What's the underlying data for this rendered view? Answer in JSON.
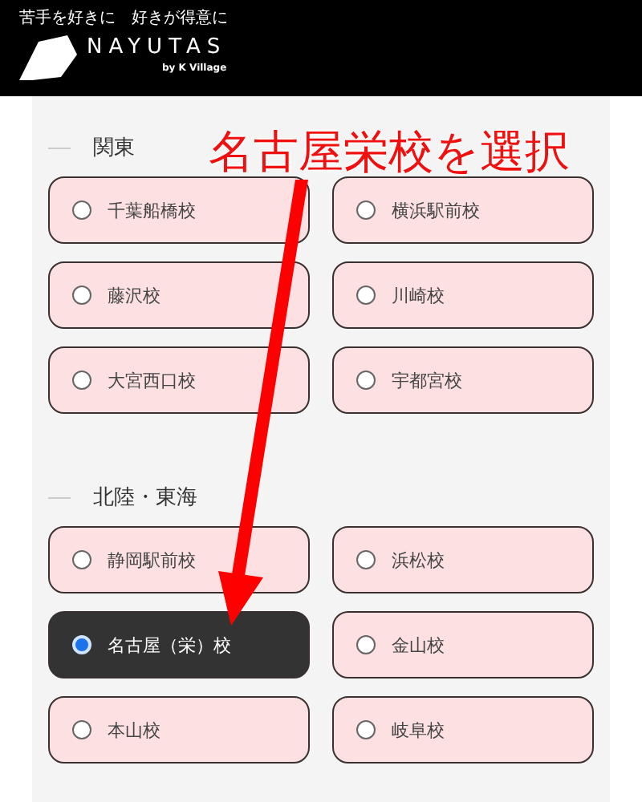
{
  "header": {
    "tagline": "苦手を好きに　好きが得意に",
    "logo_text": "NAYUTAS",
    "logo_sub": "by K Village"
  },
  "sections": [
    {
      "title": "関東",
      "options": [
        {
          "label": "千葉船橋校",
          "selected": false
        },
        {
          "label": "横浜駅前校",
          "selected": false
        },
        {
          "label": "藤沢校",
          "selected": false
        },
        {
          "label": "川崎校",
          "selected": false
        },
        {
          "label": "大宮西口校",
          "selected": false
        },
        {
          "label": "宇都宮校",
          "selected": false
        }
      ]
    },
    {
      "title": "北陸・東海",
      "options": [
        {
          "label": "静岡駅前校",
          "selected": false
        },
        {
          "label": "浜松校",
          "selected": false
        },
        {
          "label": "名古屋（栄）校",
          "selected": true
        },
        {
          "label": "金山校",
          "selected": false
        },
        {
          "label": "本山校",
          "selected": false
        },
        {
          "label": "岐阜校",
          "selected": false
        }
      ]
    }
  ],
  "annotation": {
    "text": "名古屋栄校を選択"
  }
}
